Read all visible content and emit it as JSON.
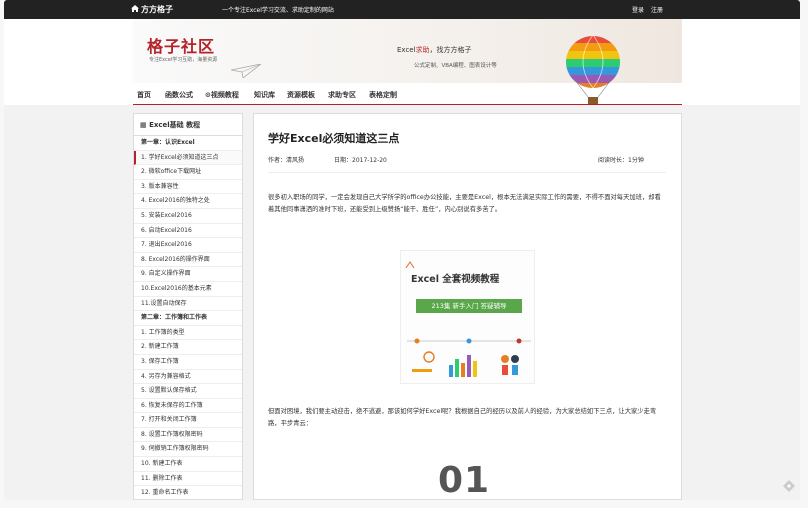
{
  "topbar": {
    "site_name": "方方格子",
    "tagline": "一个专注Excel学习交流、求助定制的网站",
    "login": "登录",
    "register": "注册"
  },
  "banner": {
    "brand": "格子社区",
    "brand_sub": "专注Excel学习互助，海量资源",
    "slogan_prefix": "Excel",
    "slogan_red": "求助",
    "slogan_suffix": "，找方方格子",
    "services": "公式定制、VBA编程、图表设计等"
  },
  "nav": {
    "items": [
      "首页",
      "函数公式",
      "⊙视频教程",
      "知识库",
      "资源模板",
      "求助专区",
      "表格定制"
    ]
  },
  "sidebar": {
    "title": "Excel基础 教程",
    "items": [
      "第一章：认识Excel",
      "1. 学好Excel必须知道这三点",
      "2. 微软office下载网址",
      "3. 版本兼容性",
      "4. Excel2016的独特之处",
      "5. 安装Excel2016",
      "6. 启动Excel2016",
      "7. 退出Excel2016",
      "8. Excel2016的操作界面",
      "9. 自定义操作界面",
      "10.Excel2016的基本元素",
      "11.设置自动保存",
      "第二章：工作簿和工作表",
      "1. 工作簿的类型",
      "2. 新建工作簿",
      "3. 保存工作簿",
      "4. 另存为兼容格式",
      "5. 设置默认保存格式",
      "6. 恢复未保存的工作簿",
      "7. 打开和关闭工作簿",
      "8. 设置工作簿权限密码",
      "9. 伺撤销工作簿权限密码",
      "10. 新建工作表",
      "11. 删除工作表",
      "12. 重命名工作表"
    ]
  },
  "article": {
    "title": "学好Excel必须知道这三点",
    "author": "作者：清风扬",
    "date": "日期：2017-12-20",
    "read_time": "阅读时长：1分钟",
    "para1": "很多初入职场的同学，一定会发现自己大学所学的office办公技能，主要是Excel，根本无法满足实际工作的需要，不得不面对每天加班，却看着其他同事潇洒的准时下班，还能受到上级赞扬“能干、胜任”，内心别说有多苦了。",
    "cover_title": "Excel 全套视频教程",
    "cover_badge": "213集  新手入门  答疑辅导",
    "para2": "但面对困境，我们要主动迎击，绝不逃避，那该如何学好Excel呢？我根据自己的经历以及前人的经验，为大家总结如下三点，让大家少走弯路，平步青云：",
    "section_num": "01"
  }
}
